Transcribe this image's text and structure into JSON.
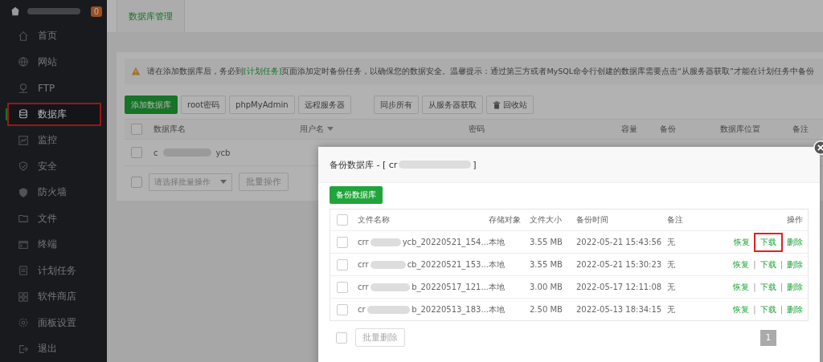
{
  "sidebar": {
    "badge": "0",
    "items": [
      {
        "label": "首页",
        "selected": false
      },
      {
        "label": "网站",
        "selected": false
      },
      {
        "label": "FTP",
        "selected": false
      },
      {
        "label": "数据库",
        "selected": true
      },
      {
        "label": "监控",
        "selected": false
      },
      {
        "label": "安全",
        "selected": false
      },
      {
        "label": "防火墙",
        "selected": false
      },
      {
        "label": "文件",
        "selected": false
      },
      {
        "label": "终端",
        "selected": false
      },
      {
        "label": "计划任务",
        "selected": false
      },
      {
        "label": "软件商店",
        "selected": false
      },
      {
        "label": "面板设置",
        "selected": false
      },
      {
        "label": "退出",
        "selected": false
      }
    ]
  },
  "tabs": [
    {
      "label": "数据库管理",
      "selected": true
    }
  ],
  "notice": {
    "text_before": "请在添加数据库后，务必到",
    "link": "[计划任务]",
    "text_after": "页面添加定时备份任务，以确保您的数据安全。温馨提示：通过第三方或者MySQL命令行创建的数据库需要点击“从服务器获取”才能在计划任务中备份"
  },
  "toolbar": [
    {
      "label": "添加数据库",
      "kind": "primary"
    },
    {
      "label": "root密码",
      "kind": "plain"
    },
    {
      "label": "phpMyAdmin",
      "kind": "plain"
    },
    {
      "label": "远程服务器",
      "kind": "plain"
    },
    {
      "label": "同步所有",
      "kind": "plain"
    },
    {
      "label": "从服务器获取",
      "kind": "plain"
    },
    {
      "label": "回收站",
      "kind": "trash"
    }
  ],
  "db_table": {
    "checked": false,
    "columns": [
      "数据库名",
      "用户名",
      "密码",
      "容量",
      "备份",
      "数据库位置",
      "备注"
    ],
    "rows": [
      {
        "checked": false,
        "name_start": "c",
        "name_end": "ycb"
      }
    ]
  },
  "batch": {
    "checked": false,
    "placeholder": "请选择批量操作",
    "button": "批量操作"
  },
  "modal": {
    "title_start": "备份数据库 - [ cr",
    "title_end": "]",
    "button": "备份数据库",
    "checked": false,
    "columns": [
      "文件名称",
      "存储对象",
      "文件大小",
      "备份时间",
      "备注",
      "操作"
    ],
    "rows": [
      {
        "checked": false,
        "name_start": "crr",
        "name_end": "ycb_20220521_154...",
        "storage": "本地",
        "size": "3.55 MB",
        "time": "2022-05-21 15:43:56",
        "note": "无",
        "actions": [
          {
            "label": "恢复",
            "highlighted": false
          },
          {
            "label": "下载",
            "highlighted": true
          },
          {
            "label": "删除",
            "highlighted": false
          }
        ]
      },
      {
        "checked": false,
        "name_start": "crr",
        "name_end": "cb_20220521_153...",
        "storage": "本地",
        "size": "3.55 MB",
        "time": "2022-05-21 15:30:23",
        "note": "无",
        "separator": "|",
        "actions": [
          {
            "label": "恢复",
            "highlighted": false
          },
          {
            "label": "下载",
            "highlighted": false
          },
          {
            "label": "删除",
            "highlighted": false
          }
        ]
      },
      {
        "checked": false,
        "name_start": "crr",
        "name_end": "b_20220517_121...",
        "storage": "本地",
        "size": "3.00 MB",
        "time": "2022-05-17 12:11:08",
        "note": "无",
        "separator": "|",
        "actions": [
          {
            "label": "恢复",
            "highlighted": false
          },
          {
            "label": "下载",
            "highlighted": false
          },
          {
            "label": "删除",
            "highlighted": false
          }
        ]
      },
      {
        "checked": false,
        "name_start": "cr",
        "name_end": "b_20220513_183...",
        "storage": "本地",
        "size": "2.50 MB",
        "time": "2022-05-13 18:34:15",
        "note": "无",
        "separator": "|",
        "actions": [
          {
            "label": "恢复",
            "highlighted": false
          },
          {
            "label": "下载",
            "highlighted": false
          },
          {
            "label": "删除",
            "highlighted": false
          }
        ]
      }
    ],
    "footer_checked": false,
    "footer_button": "批量删除",
    "page": "1"
  }
}
